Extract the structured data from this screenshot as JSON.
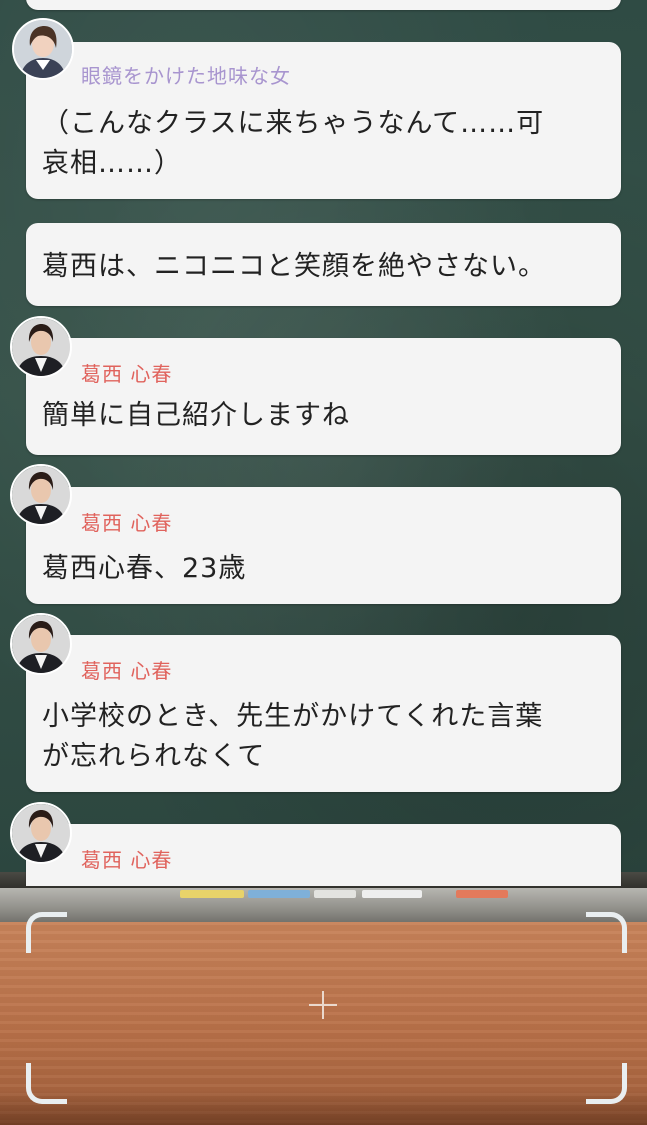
{
  "messages": [
    {
      "speaker": "眼鏡をかけた地味な女",
      "text_lines": [
        "（こんなクラスに来ちゃうなんて……可",
        "哀相……）"
      ],
      "avatar_icon": "student-girl-avatar-icon",
      "name_color": "#a895cf"
    },
    {
      "speaker": "",
      "text_lines": [
        "葛西は、ニコニコと笑顔を絶やさない。"
      ],
      "avatar_icon": "",
      "name_color": ""
    },
    {
      "speaker": "葛西 心春",
      "text_lines": [
        "簡単に自己紹介しますね"
      ],
      "avatar_icon": "teacher-woman-avatar-icon",
      "name_color": "#e0635d"
    },
    {
      "speaker": "葛西 心春",
      "text_lines": [
        "葛西心春、23歳"
      ],
      "avatar_icon": "teacher-woman-avatar-icon",
      "name_color": "#e0635d"
    },
    {
      "speaker": "葛西 心春",
      "text_lines": [
        "小学校のとき、先生がかけてくれた言葉",
        "が忘れられなくて"
      ],
      "avatar_icon": "teacher-woman-avatar-icon",
      "name_color": "#e0635d"
    },
    {
      "speaker": "葛西 心春",
      "text_lines": [],
      "avatar_icon": "teacher-woman-avatar-icon",
      "name_color": "#e0635d"
    }
  ],
  "camera_overlay": {
    "corner_icons": [
      "viewfinder-corner-icon"
    ],
    "center_icon": "crosshair-icon"
  },
  "colors": {
    "bubble_bg": "#f4f4f4",
    "text": "#222222",
    "chalkboard": "#355148",
    "desk": "#b87048"
  }
}
